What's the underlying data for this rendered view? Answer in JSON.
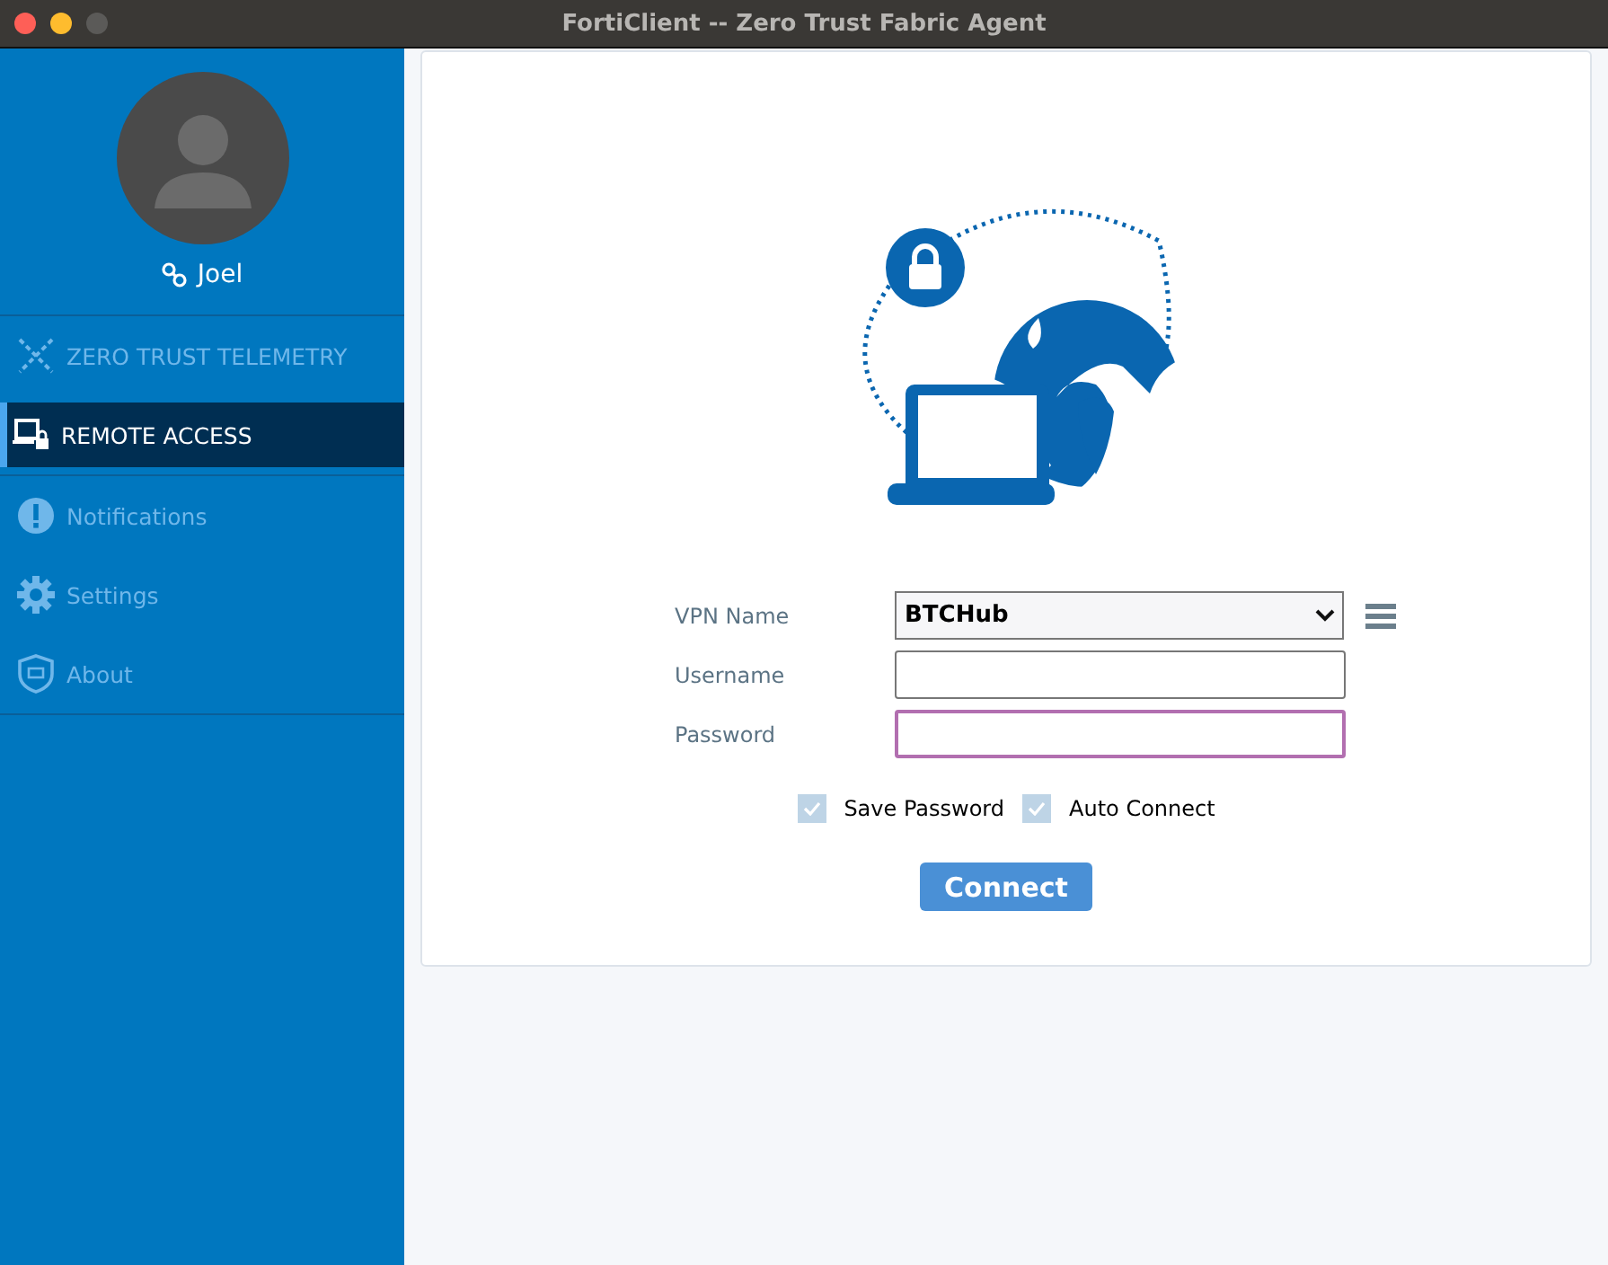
{
  "window": {
    "title": "FortiClient -- Zero Trust Fabric Agent"
  },
  "user": {
    "name": "Joel"
  },
  "sidebar": {
    "items": [
      {
        "kind": "telemetry",
        "label": "ZERO TRUST TELEMETRY",
        "selected": false
      },
      {
        "kind": "remote",
        "label": "REMOTE ACCESS",
        "selected": true
      },
      {
        "kind": "notifications",
        "label": "Notifications",
        "selected": false
      },
      {
        "kind": "settings",
        "label": "Settings",
        "selected": false
      },
      {
        "kind": "about",
        "label": "About",
        "selected": false
      }
    ]
  },
  "form": {
    "vpn_name": {
      "label": "VPN Name",
      "value": "BTCHub"
    },
    "username": {
      "label": "Username"
    },
    "password": {
      "label": "Password",
      "focused": true
    },
    "options": [
      {
        "label": "Save Password",
        "checked": true,
        "disabled": true
      },
      {
        "label": "Auto Connect",
        "checked": true,
        "disabled": true
      }
    ],
    "connect_button": "Connect"
  }
}
